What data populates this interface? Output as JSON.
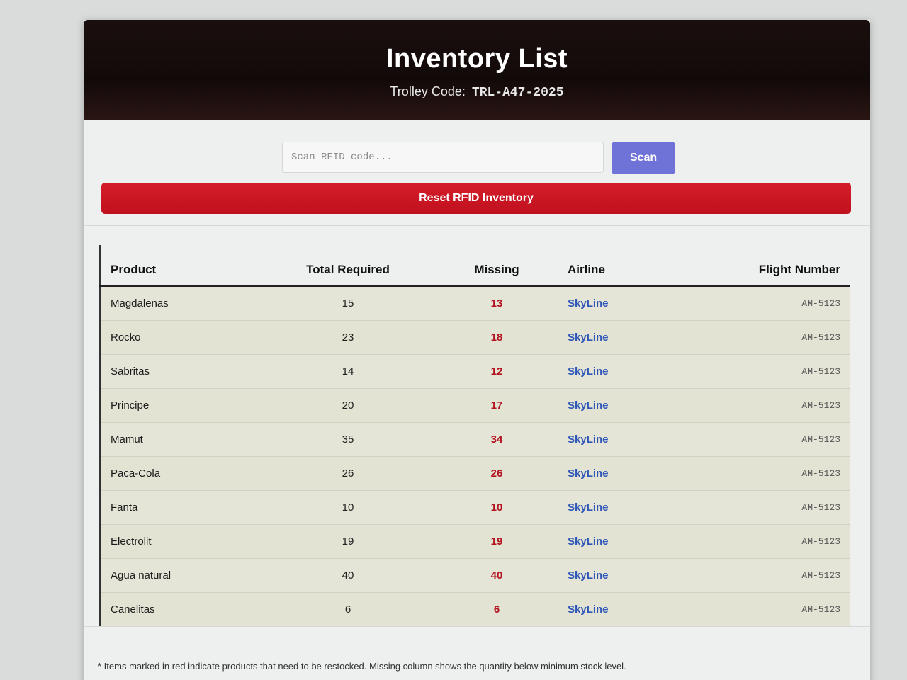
{
  "header": {
    "title": "Inventory List",
    "trolley_label": "Trolley Code:",
    "trolley_code": "TRL-A47-2025"
  },
  "controls": {
    "scan_placeholder": "Scan RFID code...",
    "scan_button": "Scan",
    "reset_button": "Reset RFID Inventory"
  },
  "table": {
    "columns": [
      "Product",
      "Total Required",
      "Missing",
      "Airline",
      "Flight Number"
    ],
    "rows": [
      {
        "product": "Magdalenas",
        "total": "15",
        "missing": "13",
        "airline": "SkyLine",
        "flight": "AM-5123"
      },
      {
        "product": "Rocko",
        "total": "23",
        "missing": "18",
        "airline": "SkyLine",
        "flight": "AM-5123"
      },
      {
        "product": "Sabritas",
        "total": "14",
        "missing": "12",
        "airline": "SkyLine",
        "flight": "AM-5123"
      },
      {
        "product": "Principe",
        "total": "20",
        "missing": "17",
        "airline": "SkyLine",
        "flight": "AM-5123"
      },
      {
        "product": "Mamut",
        "total": "35",
        "missing": "34",
        "airline": "SkyLine",
        "flight": "AM-5123"
      },
      {
        "product": "Paca-Cola",
        "total": "26",
        "missing": "26",
        "airline": "SkyLine",
        "flight": "AM-5123"
      },
      {
        "product": "Fanta",
        "total": "10",
        "missing": "10",
        "airline": "SkyLine",
        "flight": "AM-5123"
      },
      {
        "product": "Electrolit",
        "total": "19",
        "missing": "19",
        "airline": "SkyLine",
        "flight": "AM-5123"
      },
      {
        "product": "Agua natural",
        "total": "40",
        "missing": "40",
        "airline": "SkyLine",
        "flight": "AM-5123"
      },
      {
        "product": "Canelitas",
        "total": "6",
        "missing": "6",
        "airline": "SkyLine",
        "flight": "AM-5123"
      }
    ]
  },
  "notes": {
    "line1": "* Items marked in red indicate products that need to be restocked. Missing column shows the quantity below minimum stock level."
  },
  "colors": {
    "header_bg": "#120a09",
    "scan_button": "#6f72d6",
    "reset_button": "#c0101e",
    "missing_text": "#b3121f",
    "airline_text": "#2f56b8"
  }
}
